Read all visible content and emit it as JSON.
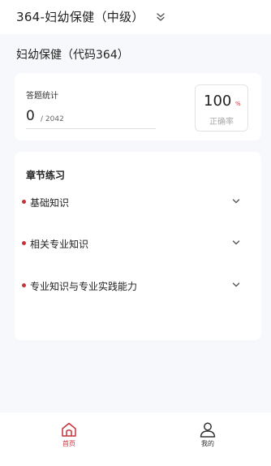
{
  "header": {
    "course_title": "364-妇幼保健（中级）",
    "switch_icon": "double-chevron-down-icon"
  },
  "subject": {
    "name": "妇幼保健（代码364）"
  },
  "stats": {
    "label": "答题统计",
    "answered": "0",
    "total": "/ 2042",
    "progress_fraction": 0,
    "accuracy_value": "100",
    "accuracy_unit": "%",
    "accuracy_label": "正确率"
  },
  "chapters": {
    "title": "章节练习",
    "items": [
      {
        "label": "基础知识",
        "icon": "chevron-down-icon"
      },
      {
        "label": "相关专业知识",
        "icon": "chevron-down-icon"
      },
      {
        "label": "专业知识与专业实践能力",
        "icon": "chevron-down-icon"
      }
    ]
  },
  "tabbar": {
    "items": [
      {
        "label": "首页",
        "icon": "home-icon",
        "active": true
      },
      {
        "label": "我的",
        "icon": "user-icon",
        "active": false
      }
    ]
  },
  "colors": {
    "accent": "#c9313a",
    "background": "#f7f8fc",
    "card": "#ffffff"
  }
}
